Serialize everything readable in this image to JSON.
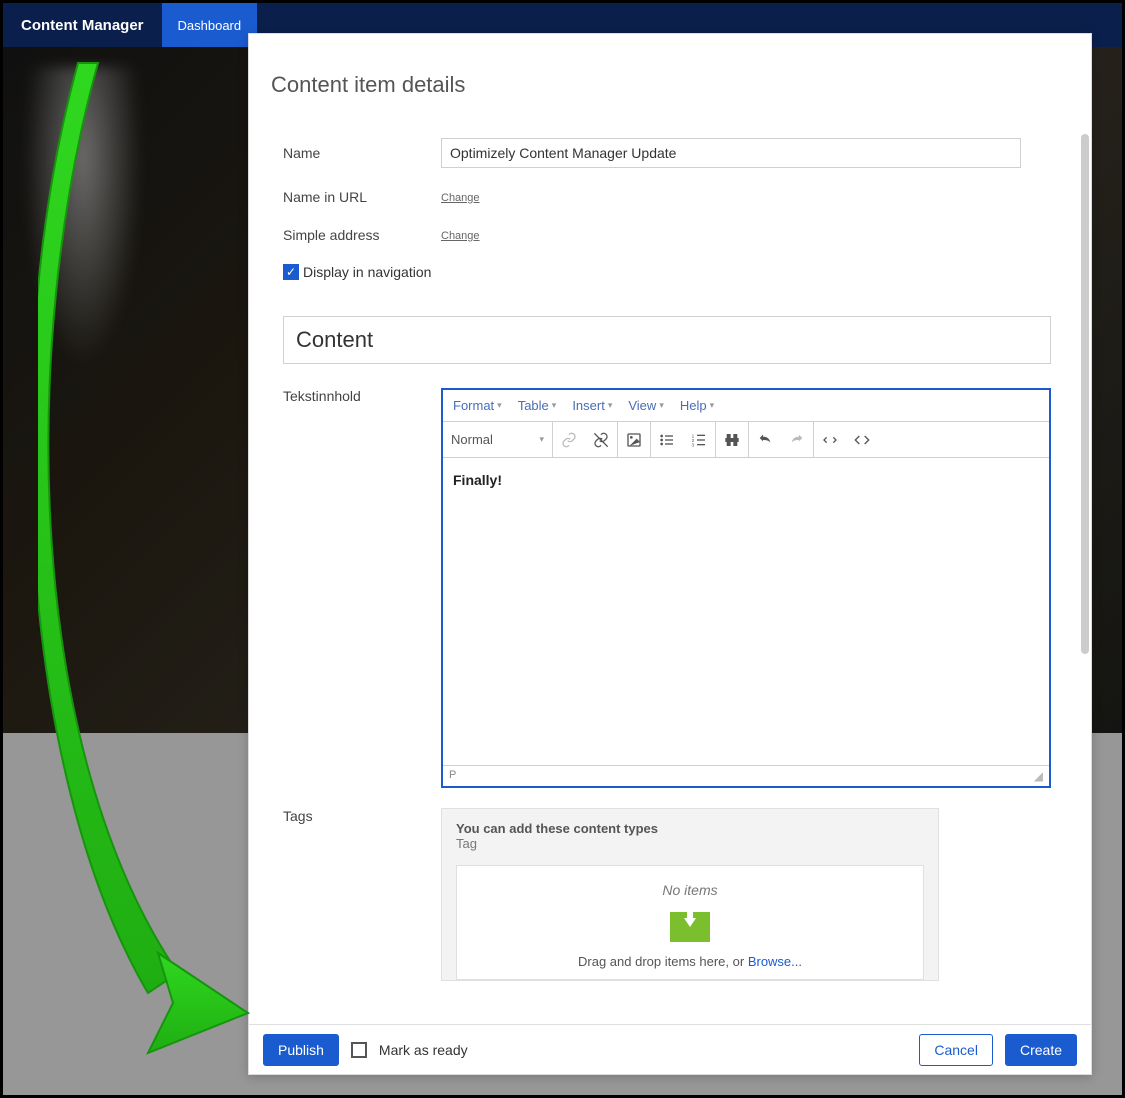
{
  "topnav": {
    "brand": "Content Manager",
    "tab_active": "Dashboard"
  },
  "modal": {
    "title": "Content item details",
    "fields": {
      "name_label": "Name",
      "name_value": "Optimizely Content Manager Update",
      "name_in_url_label": "Name in URL",
      "name_in_url_action": "Change",
      "simple_address_label": "Simple address",
      "simple_address_action": "Change",
      "display_nav_label": "Display in navigation",
      "display_nav_checked": true
    },
    "section_content": "Content",
    "rte": {
      "field_label": "Tekstinnhold",
      "menus": {
        "format": "Format",
        "table": "Table",
        "insert": "Insert",
        "view": "View",
        "help": "Help"
      },
      "format_style": "Normal",
      "content": "Finally!",
      "status_path": "P"
    },
    "tags": {
      "field_label": "Tags",
      "head1": "You can add these content types",
      "head2": "Tag",
      "no_items": "No items",
      "drag_text": "Drag and drop items here, or ",
      "browse": "Browse..."
    },
    "footer": {
      "publish": "Publish",
      "mark_ready": "Mark as ready",
      "cancel": "Cancel",
      "create": "Create"
    }
  }
}
